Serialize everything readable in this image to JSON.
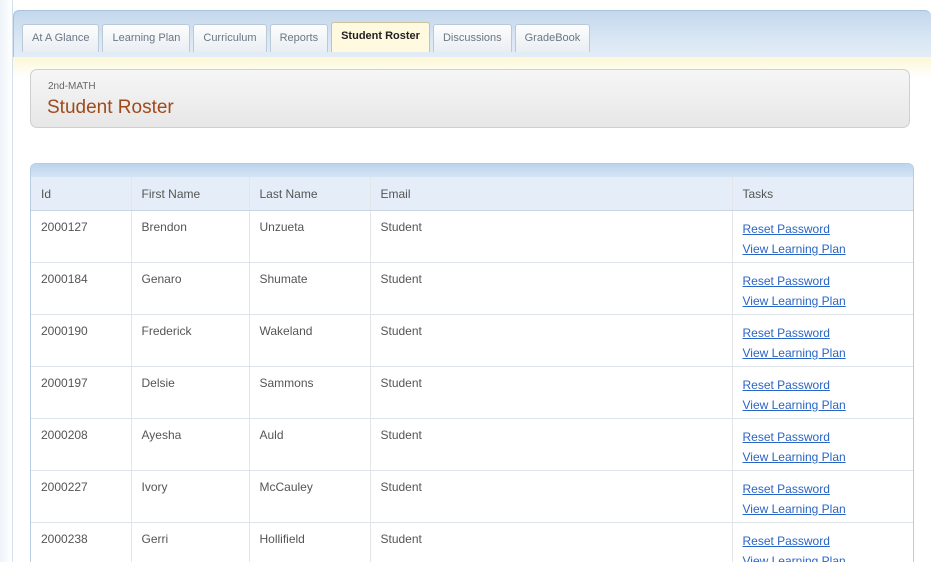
{
  "tabs": [
    {
      "label": "At A Glance",
      "active": false
    },
    {
      "label": "Learning Plan",
      "active": false
    },
    {
      "label": "Curriculum",
      "active": false
    },
    {
      "label": "Reports",
      "active": false
    },
    {
      "label": "Student Roster",
      "active": true
    },
    {
      "label": "Discussions",
      "active": false
    },
    {
      "label": "GradeBook",
      "active": false
    }
  ],
  "header": {
    "course_code": "2nd-MATH",
    "title": "Student Roster"
  },
  "roster": {
    "columns": [
      "Id",
      "First Name",
      "Last Name",
      "Email",
      "Tasks"
    ],
    "task_labels": {
      "reset_password": "Reset Password",
      "view_learning_plan": "View Learning Plan"
    },
    "rows": [
      {
        "id": "2000127",
        "first": "Brendon",
        "last": "Unzueta",
        "email": "Student"
      },
      {
        "id": "2000184",
        "first": "Genaro",
        "last": "Shumate",
        "email": "Student"
      },
      {
        "id": "2000190",
        "first": "Frederick",
        "last": "Wakeland",
        "email": "Student"
      },
      {
        "id": "2000197",
        "first": "Delsie",
        "last": "Sammons",
        "email": "Student"
      },
      {
        "id": "2000208",
        "first": "Ayesha",
        "last": "Auld",
        "email": "Student"
      },
      {
        "id": "2000227",
        "first": "Ivory",
        "last": "McCauley",
        "email": "Student"
      },
      {
        "id": "2000238",
        "first": "Gerri",
        "last": "Hollifield",
        "email": "Student"
      }
    ]
  },
  "colors": {
    "title": "#a04a1a",
    "link": "#2a64c5",
    "tab_active_bg": "#fff9e0",
    "header_band": "#e5eef8"
  }
}
